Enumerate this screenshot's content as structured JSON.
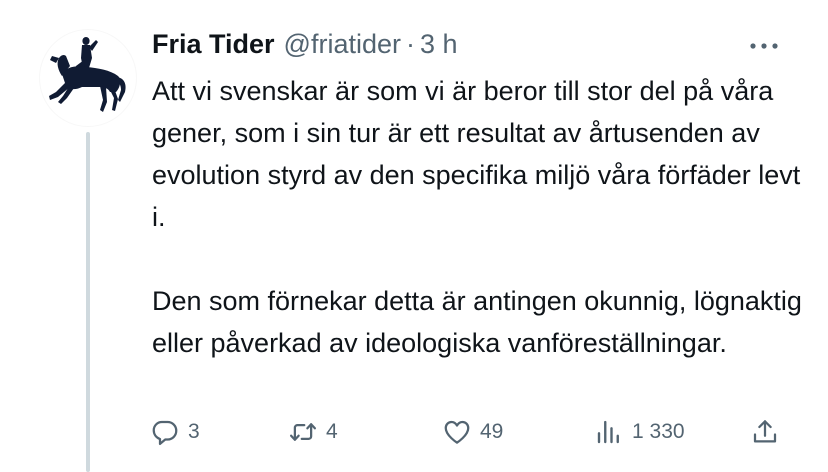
{
  "tweet": {
    "author_name": "Fria Tider",
    "author_handle": "@friatider",
    "separator": "·",
    "time": "3 h",
    "paragraphs": [
      "Att vi svenskar är som vi är beror till stor del på våra gener, som i sin tur är ett resultat av årtusenden av evolution styrd av den specifika miljö våra förfäder levt i.",
      "Den som förnekar detta är antingen okunnig, lögnaktig eller påverkad av ideologiska vanföreställningar."
    ],
    "stats": {
      "replies": "3",
      "retweets": "4",
      "likes": "49",
      "views": "1 330"
    }
  },
  "icons": {
    "avatar": "equestrian-statue-silhouette",
    "more": "more-horizontal-icon",
    "reply": "reply-icon",
    "retweet": "retweet-icon",
    "like": "heart-icon",
    "views": "views-chart-icon",
    "share": "share-icon"
  },
  "colors": {
    "text": "#0f1419",
    "secondary": "#536471",
    "thread_line": "#cfd9de",
    "avatar_silhouette": "#101b33"
  }
}
